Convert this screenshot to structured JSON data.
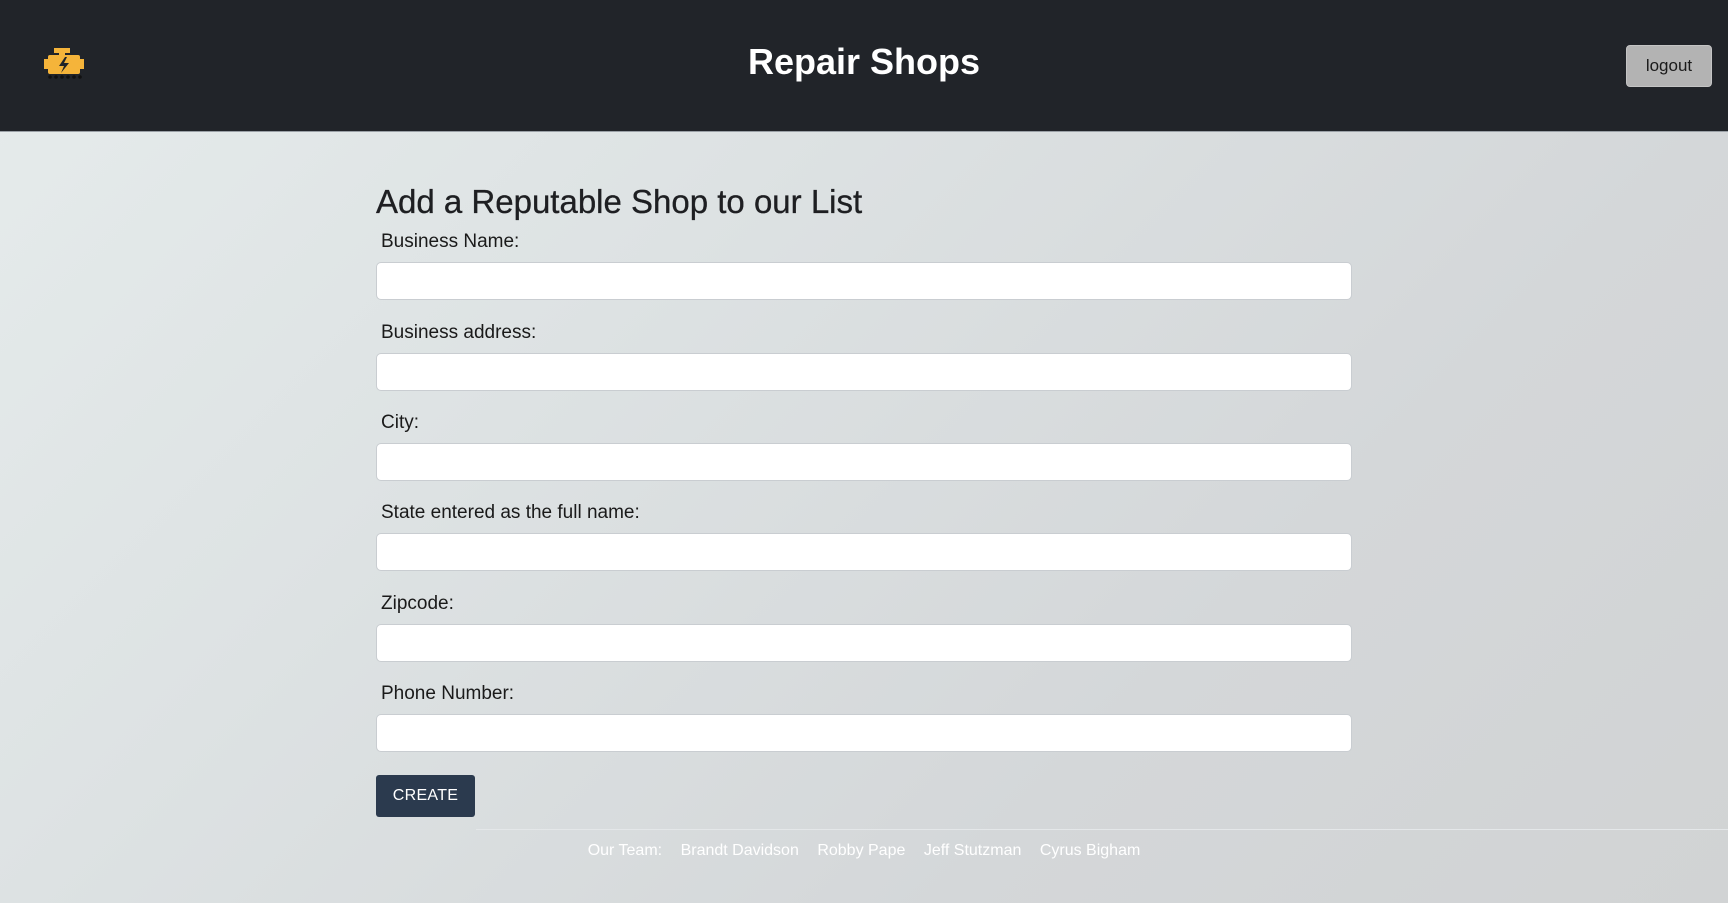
{
  "header": {
    "logo_icon": "engine-icon",
    "title": "Repair Shops",
    "logout_label": "logout"
  },
  "form": {
    "title": "Add a Reputable Shop to our List",
    "fields": [
      {
        "label": "Business Name:",
        "value": ""
      },
      {
        "label": "Business address:",
        "value": ""
      },
      {
        "label": "City:",
        "value": ""
      },
      {
        "label": "State entered as the full name:",
        "value": ""
      },
      {
        "label": "Zipcode:",
        "value": ""
      },
      {
        "label": "Phone Number:",
        "value": ""
      }
    ],
    "submit_label": "CREATE"
  },
  "footer": {
    "team_label": "Our Team:",
    "members": [
      "Brandt Davidson",
      "Robby Pape",
      "Jeff Stutzman",
      "Cyrus Bigham"
    ]
  },
  "colors": {
    "header_bg": "#212429",
    "logo_accent": "#f5b43a",
    "create_button": "#2b3a4e",
    "logout_button": "#b3b3b3"
  }
}
